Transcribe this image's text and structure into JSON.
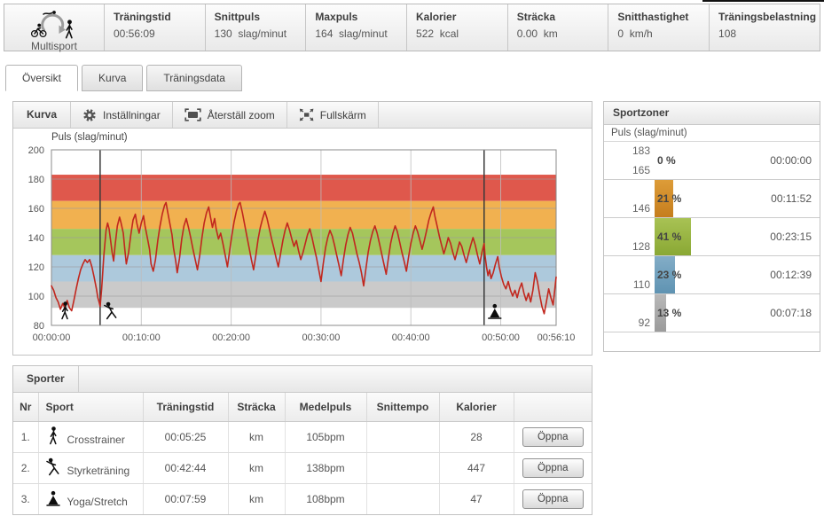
{
  "topbar": {
    "sport_label": "Multisport",
    "metrics": [
      {
        "label": "Träningstid",
        "value": "00:56:09",
        "unit": ""
      },
      {
        "label": "Snittpuls",
        "value": "130",
        "unit": "slag/minut"
      },
      {
        "label": "Maxpuls",
        "value": "164",
        "unit": "slag/minut"
      },
      {
        "label": "Kalorier",
        "value": "522",
        "unit": "kcal"
      },
      {
        "label": "Sträcka",
        "value": "0.00",
        "unit": "km"
      },
      {
        "label": "Snitthastighet",
        "value": "0",
        "unit": "km/h"
      },
      {
        "label": "Träningsbelastning",
        "value": "108",
        "unit": ""
      }
    ]
  },
  "tabs": [
    {
      "label": "Översikt",
      "active": true
    },
    {
      "label": "Kurva",
      "active": false
    },
    {
      "label": "Träningsdata",
      "active": false
    }
  ],
  "curve_panel": {
    "title": "Kurva",
    "buttons": [
      {
        "icon": "gear-icon",
        "label": "Inställningar"
      },
      {
        "icon": "reset-zoom-icon",
        "label": "Återställ zoom"
      },
      {
        "icon": "fullscreen-icon",
        "label": "Fullskärm"
      }
    ]
  },
  "chart_data": {
    "type": "line",
    "title": "Puls (slag/minut)",
    "ylabel": "Puls (slag/minut)",
    "ylim": [
      80,
      200
    ],
    "yticks": [
      80,
      100,
      120,
      140,
      160,
      180,
      200
    ],
    "xlim_seconds": [
      0,
      3370
    ],
    "xticks": [
      {
        "sec": 0,
        "label": "00:00:00"
      },
      {
        "sec": 600,
        "label": "00:10:00"
      },
      {
        "sec": 1200,
        "label": "00:20:00"
      },
      {
        "sec": 1800,
        "label": "00:30:00"
      },
      {
        "sec": 2400,
        "label": "00:40:00"
      },
      {
        "sec": 3000,
        "label": "00:50:00"
      },
      {
        "sec": 3370,
        "label": "00:56:10"
      }
    ],
    "zones": [
      {
        "from": 165,
        "to": 183,
        "color": "#df584c"
      },
      {
        "from": 146,
        "to": 165,
        "color": "#f1b150"
      },
      {
        "from": 128,
        "to": 146,
        "color": "#a5c65c"
      },
      {
        "from": 110,
        "to": 128,
        "color": "#adc9dc"
      },
      {
        "from": 92,
        "to": 110,
        "color": "#cacaca"
      }
    ],
    "markers": [
      {
        "sec": 90,
        "icon": "crosstrainer-icon",
        "line": false
      },
      {
        "sec": 325,
        "icon": "strength-icon",
        "line": true
      },
      {
        "sec": 2889,
        "icon": "yoga-icon",
        "line": true
      }
    ],
    "line_color": "#c1271e",
    "series": [
      {
        "name": "Puls",
        "points": [
          [
            0,
            107
          ],
          [
            15,
            104
          ],
          [
            30,
            99
          ],
          [
            45,
            96
          ],
          [
            60,
            91
          ],
          [
            75,
            95
          ],
          [
            90,
            92
          ],
          [
            105,
            97
          ],
          [
            120,
            92
          ],
          [
            135,
            90
          ],
          [
            150,
            97
          ],
          [
            165,
            105
          ],
          [
            180,
            112
          ],
          [
            195,
            118
          ],
          [
            210,
            122
          ],
          [
            225,
            125
          ],
          [
            240,
            123
          ],
          [
            255,
            125
          ],
          [
            270,
            120
          ],
          [
            285,
            113
          ],
          [
            300,
            105
          ],
          [
            310,
            99
          ],
          [
            318,
            96
          ],
          [
            325,
            93
          ],
          [
            335,
            105
          ],
          [
            350,
            128
          ],
          [
            365,
            145
          ],
          [
            375,
            150
          ],
          [
            385,
            146
          ],
          [
            395,
            138
          ],
          [
            405,
            130
          ],
          [
            415,
            124
          ],
          [
            425,
            135
          ],
          [
            440,
            148
          ],
          [
            455,
            154
          ],
          [
            465,
            150
          ],
          [
            480,
            143
          ],
          [
            490,
            132
          ],
          [
            500,
            122
          ],
          [
            515,
            130
          ],
          [
            530,
            142
          ],
          [
            545,
            152
          ],
          [
            560,
            156
          ],
          [
            570,
            150
          ],
          [
            585,
            143
          ],
          [
            600,
            150
          ],
          [
            615,
            155
          ],
          [
            625,
            148
          ],
          [
            640,
            140
          ],
          [
            655,
            132
          ],
          [
            665,
            122
          ],
          [
            680,
            117
          ],
          [
            695,
            125
          ],
          [
            710,
            138
          ],
          [
            725,
            148
          ],
          [
            740,
            156
          ],
          [
            755,
            162
          ],
          [
            765,
            164
          ],
          [
            775,
            158
          ],
          [
            790,
            150
          ],
          [
            805,
            142
          ],
          [
            815,
            133
          ],
          [
            830,
            124
          ],
          [
            840,
            116
          ],
          [
            855,
            126
          ],
          [
            870,
            139
          ],
          [
            885,
            148
          ],
          [
            900,
            153
          ],
          [
            915,
            147
          ],
          [
            930,
            140
          ],
          [
            945,
            132
          ],
          [
            960,
            125
          ],
          [
            975,
            118
          ],
          [
            990,
            128
          ],
          [
            1005,
            140
          ],
          [
            1020,
            150
          ],
          [
            1035,
            157
          ],
          [
            1050,
            161
          ],
          [
            1060,
            155
          ],
          [
            1075,
            147
          ],
          [
            1090,
            153
          ],
          [
            1100,
            146
          ],
          [
            1115,
            139
          ],
          [
            1130,
            143
          ],
          [
            1145,
            136
          ],
          [
            1160,
            128
          ],
          [
            1175,
            120
          ],
          [
            1190,
            131
          ],
          [
            1205,
            142
          ],
          [
            1220,
            151
          ],
          [
            1235,
            158
          ],
          [
            1250,
            163
          ],
          [
            1260,
            164
          ],
          [
            1275,
            157
          ],
          [
            1290,
            149
          ],
          [
            1305,
            141
          ],
          [
            1320,
            133
          ],
          [
            1335,
            125
          ],
          [
            1350,
            118
          ],
          [
            1365,
            128
          ],
          [
            1380,
            139
          ],
          [
            1395,
            147
          ],
          [
            1410,
            153
          ],
          [
            1425,
            158
          ],
          [
            1440,
            153
          ],
          [
            1455,
            146
          ],
          [
            1470,
            139
          ],
          [
            1485,
            133
          ],
          [
            1500,
            126
          ],
          [
            1515,
            120
          ],
          [
            1530,
            129
          ],
          [
            1545,
            138
          ],
          [
            1560,
            145
          ],
          [
            1575,
            150
          ],
          [
            1590,
            145
          ],
          [
            1605,
            139
          ],
          [
            1620,
            134
          ],
          [
            1635,
            138
          ],
          [
            1650,
            131
          ],
          [
            1665,
            125
          ],
          [
            1680,
            130
          ],
          [
            1695,
            136
          ],
          [
            1710,
            142
          ],
          [
            1725,
            146
          ],
          [
            1740,
            140
          ],
          [
            1755,
            133
          ],
          [
            1770,
            126
          ],
          [
            1785,
            118
          ],
          [
            1800,
            110
          ],
          [
            1815,
            122
          ],
          [
            1830,
            133
          ],
          [
            1845,
            140
          ],
          [
            1860,
            145
          ],
          [
            1875,
            141
          ],
          [
            1890,
            135
          ],
          [
            1905,
            128
          ],
          [
            1920,
            121
          ],
          [
            1935,
            114
          ],
          [
            1950,
            125
          ],
          [
            1965,
            135
          ],
          [
            1980,
            142
          ],
          [
            1995,
            147
          ],
          [
            2010,
            143
          ],
          [
            2025,
            136
          ],
          [
            2040,
            129
          ],
          [
            2055,
            123
          ],
          [
            2070,
            116
          ],
          [
            2085,
            107
          ],
          [
            2100,
            119
          ],
          [
            2115,
            130
          ],
          [
            2130,
            138
          ],
          [
            2145,
            144
          ],
          [
            2160,
            148
          ],
          [
            2175,
            143
          ],
          [
            2190,
            136
          ],
          [
            2205,
            129
          ],
          [
            2220,
            122
          ],
          [
            2235,
            115
          ],
          [
            2250,
            126
          ],
          [
            2265,
            136
          ],
          [
            2280,
            143
          ],
          [
            2295,
            148
          ],
          [
            2310,
            144
          ],
          [
            2325,
            137
          ],
          [
            2340,
            130
          ],
          [
            2355,
            124
          ],
          [
            2370,
            117
          ],
          [
            2385,
            127
          ],
          [
            2400,
            136
          ],
          [
            2415,
            143
          ],
          [
            2430,
            148
          ],
          [
            2445,
            144
          ],
          [
            2460,
            138
          ],
          [
            2475,
            132
          ],
          [
            2490,
            138
          ],
          [
            2505,
            145
          ],
          [
            2520,
            152
          ],
          [
            2535,
            157
          ],
          [
            2550,
            161
          ],
          [
            2560,
            155
          ],
          [
            2575,
            148
          ],
          [
            2590,
            141
          ],
          [
            2605,
            135
          ],
          [
            2620,
            129
          ],
          [
            2635,
            134
          ],
          [
            2650,
            140
          ],
          [
            2665,
            136
          ],
          [
            2680,
            130
          ],
          [
            2695,
            125
          ],
          [
            2710,
            131
          ],
          [
            2725,
            137
          ],
          [
            2740,
            134
          ],
          [
            2755,
            128
          ],
          [
            2770,
            123
          ],
          [
            2785,
            129
          ],
          [
            2800,
            135
          ],
          [
            2815,
            140
          ],
          [
            2830,
            135
          ],
          [
            2845,
            128
          ],
          [
            2860,
            122
          ],
          [
            2875,
            130
          ],
          [
            2889,
            136
          ],
          [
            2895,
            128
          ],
          [
            2905,
            120
          ],
          [
            2915,
            114
          ],
          [
            2925,
            118
          ],
          [
            2935,
            112
          ],
          [
            2950,
            116
          ],
          [
            2965,
            122
          ],
          [
            2980,
            127
          ],
          [
            2990,
            120
          ],
          [
            3005,
            113
          ],
          [
            3020,
            108
          ],
          [
            3035,
            105
          ],
          [
            3050,
            110
          ],
          [
            3065,
            104
          ],
          [
            3080,
            100
          ],
          [
            3095,
            104
          ],
          [
            3110,
            99
          ],
          [
            3125,
            105
          ],
          [
            3140,
            109
          ],
          [
            3155,
            102
          ],
          [
            3170,
            97
          ],
          [
            3185,
            102
          ],
          [
            3200,
            96
          ],
          [
            3215,
            104
          ],
          [
            3230,
            116
          ],
          [
            3245,
            110
          ],
          [
            3260,
            101
          ],
          [
            3275,
            93
          ],
          [
            3290,
            88
          ],
          [
            3305,
            96
          ],
          [
            3320,
            105
          ],
          [
            3335,
            99
          ],
          [
            3350,
            94
          ],
          [
            3370,
            113
          ]
        ]
      }
    ]
  },
  "sportzones": {
    "title": "Sportzoner",
    "subtitle": "Puls (slag/minut)",
    "zones": [
      {
        "upper": 183,
        "lower": 165,
        "pct": 0,
        "pct_label": "0 %",
        "time": "00:00:00",
        "color": "",
        "color2": ""
      },
      {
        "lower": 146,
        "pct": 21,
        "pct_label": "21 %",
        "time": "00:11:52",
        "color": "#dd9c38",
        "color2": "#c57d1d"
      },
      {
        "lower": 128,
        "pct": 41,
        "pct_label": "41 %",
        "time": "00:23:15",
        "color": "#a8c254",
        "color2": "#8aa834"
      },
      {
        "lower": 110,
        "pct": 23,
        "pct_label": "23 %",
        "time": "00:12:39",
        "color": "#83adc7",
        "color2": "#5f93b2"
      },
      {
        "lower": 92,
        "pct": 13,
        "pct_label": "13 %",
        "time": "00:07:18",
        "color": "#b8b8b8",
        "color2": "#9b9b9b"
      }
    ]
  },
  "sports": {
    "title": "Sporter",
    "columns": [
      "Nr",
      "Sport",
      "Träningstid",
      "Sträcka",
      "Medelpuls",
      "Snittempo",
      "Kalorier",
      ""
    ],
    "open_label": "Öppna",
    "rows": [
      {
        "nr": "1.",
        "icon": "crosstrainer-icon",
        "sport": "Crosstrainer",
        "time": "00:05:25",
        "distance": "km",
        "avg_hr": "105bpm",
        "pace": "",
        "calories": "28"
      },
      {
        "nr": "2.",
        "icon": "strength-icon",
        "sport": "Styrketräning",
        "time": "00:42:44",
        "distance": "km",
        "avg_hr": "138bpm",
        "pace": "",
        "calories": "447"
      },
      {
        "nr": "3.",
        "icon": "yoga-icon",
        "sport": "Yoga/Stretch",
        "time": "00:07:59",
        "distance": "km",
        "avg_hr": "108bpm",
        "pace": "",
        "calories": "47"
      }
    ]
  }
}
